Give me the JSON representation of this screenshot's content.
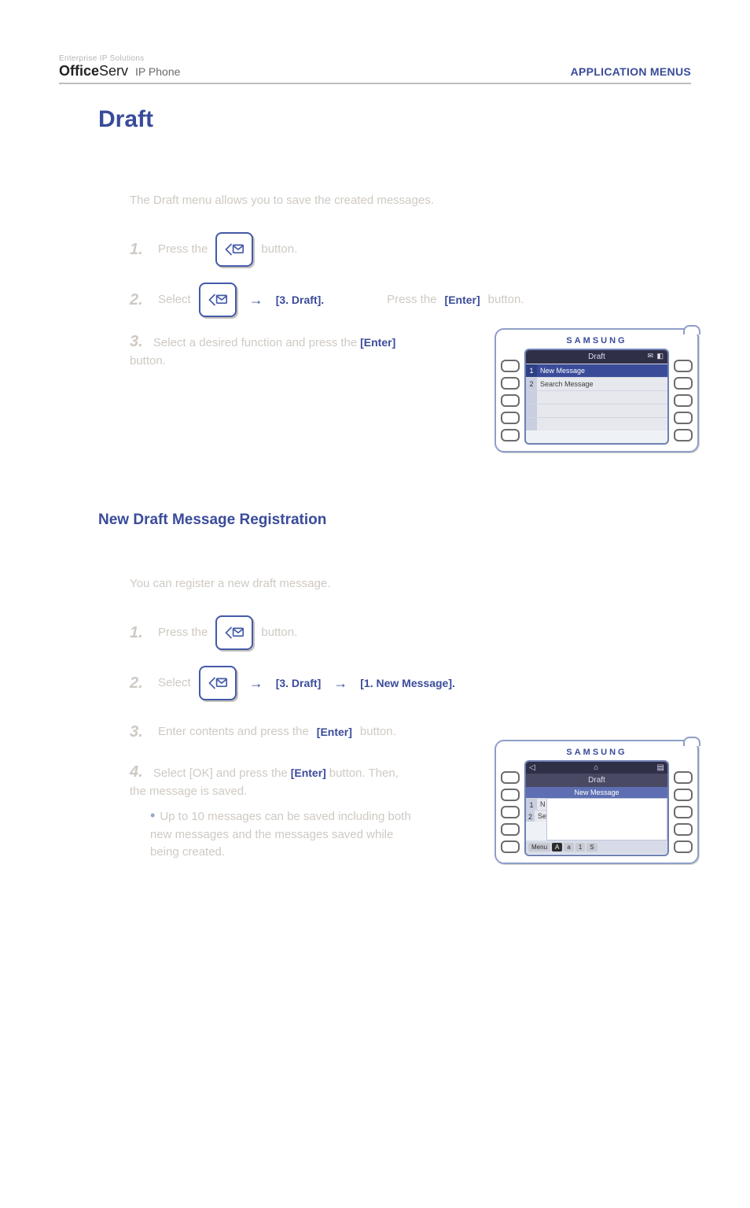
{
  "header": {
    "brand_top": "Enterprise IP Solutions",
    "brand_bold": "Office",
    "brand_rest": "Serv",
    "brand_sub": "IP Phone",
    "right": "APPLICATION MENUS"
  },
  "section1": {
    "title": "Draft",
    "ghost_intro": "The Draft menu allows you to save the created messages.",
    "step1_pre": "Press the",
    "step1_post": "button.",
    "step2_pre": "Select",
    "step2_path": "[3. Draft].",
    "step2_post": "Press the",
    "key_enter": "[Enter]",
    "step2_tail": "button.",
    "step3_pre": "Select a desired function and press the",
    "step3_tail": "button."
  },
  "phoneA": {
    "brand": "SAMSUNG",
    "header": "Draft",
    "rows": [
      {
        "n": "1",
        "label": "New Message",
        "selected": true
      },
      {
        "n": "2",
        "label": "Search Message",
        "selected": false
      }
    ]
  },
  "section2": {
    "title": "New Draft Message Registration",
    "ghost_intro": "You can register a new draft message.",
    "step1_pre": "Press the",
    "step1_post": "button.",
    "step2_pre": "Select",
    "step2_path_a": "[3. Draft]",
    "step2_path_b": "[1. New Message].",
    "step3_pre": "Enter contents and press the",
    "key_enter": "[Enter]",
    "step3_tail": "button.",
    "step4_pre": "Select [OK] and press the",
    "step4_tail": "button. Then, the message is saved.",
    "note": "Up to 10 messages can be saved including both new messages and the messages saved while being created."
  },
  "phoneB": {
    "brand": "SAMSUNG",
    "header": "Draft",
    "sub": "New Message",
    "rows_left": [
      {
        "n": "1",
        "code": "N"
      },
      {
        "n": "2",
        "code": "Se"
      }
    ],
    "foot": {
      "menu": "Menu",
      "caps": "A",
      "lower": "a",
      "num": "1",
      "sym": "S"
    }
  }
}
